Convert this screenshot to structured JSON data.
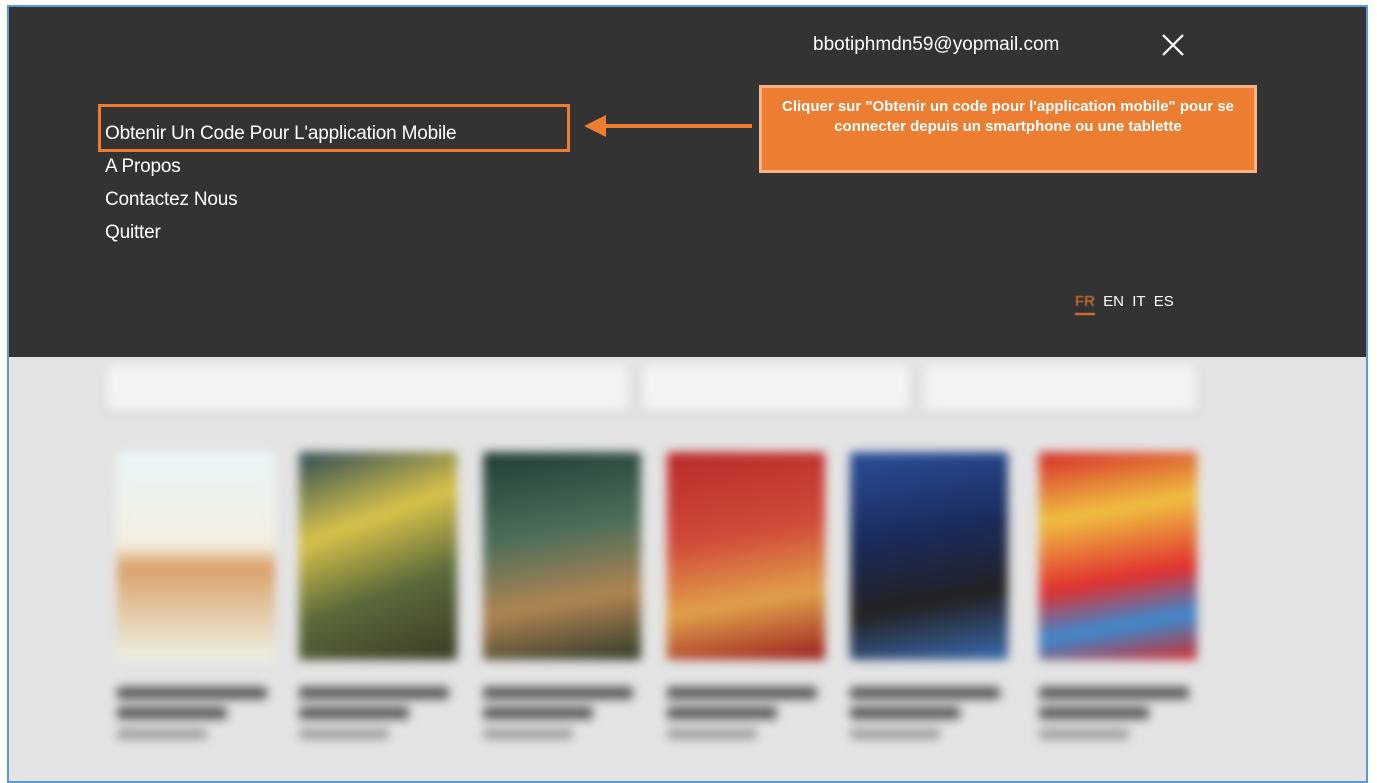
{
  "user": {
    "email": "bbotiphmdn59@yopmail.com"
  },
  "menu": {
    "items": [
      {
        "label": "Obtenir Un Code Pour L'application Mobile"
      },
      {
        "label": "A Propos"
      },
      {
        "label": "Contactez Nous"
      },
      {
        "label": "Quitter"
      }
    ]
  },
  "callout": {
    "text": "Cliquer sur \"Obtenir un code pour l'application mobile\" pour se connecter depuis un smartphone ou une tablette"
  },
  "languages": [
    {
      "code": "FR",
      "active": true
    },
    {
      "code": "EN",
      "active": false
    },
    {
      "code": "IT",
      "active": false
    },
    {
      "code": "ES",
      "active": false
    }
  ],
  "colors": {
    "overlay": "#333333",
    "accent": "#ed7d31",
    "frame_border": "#5b9bd5"
  },
  "icons": {
    "close": "close-icon"
  }
}
